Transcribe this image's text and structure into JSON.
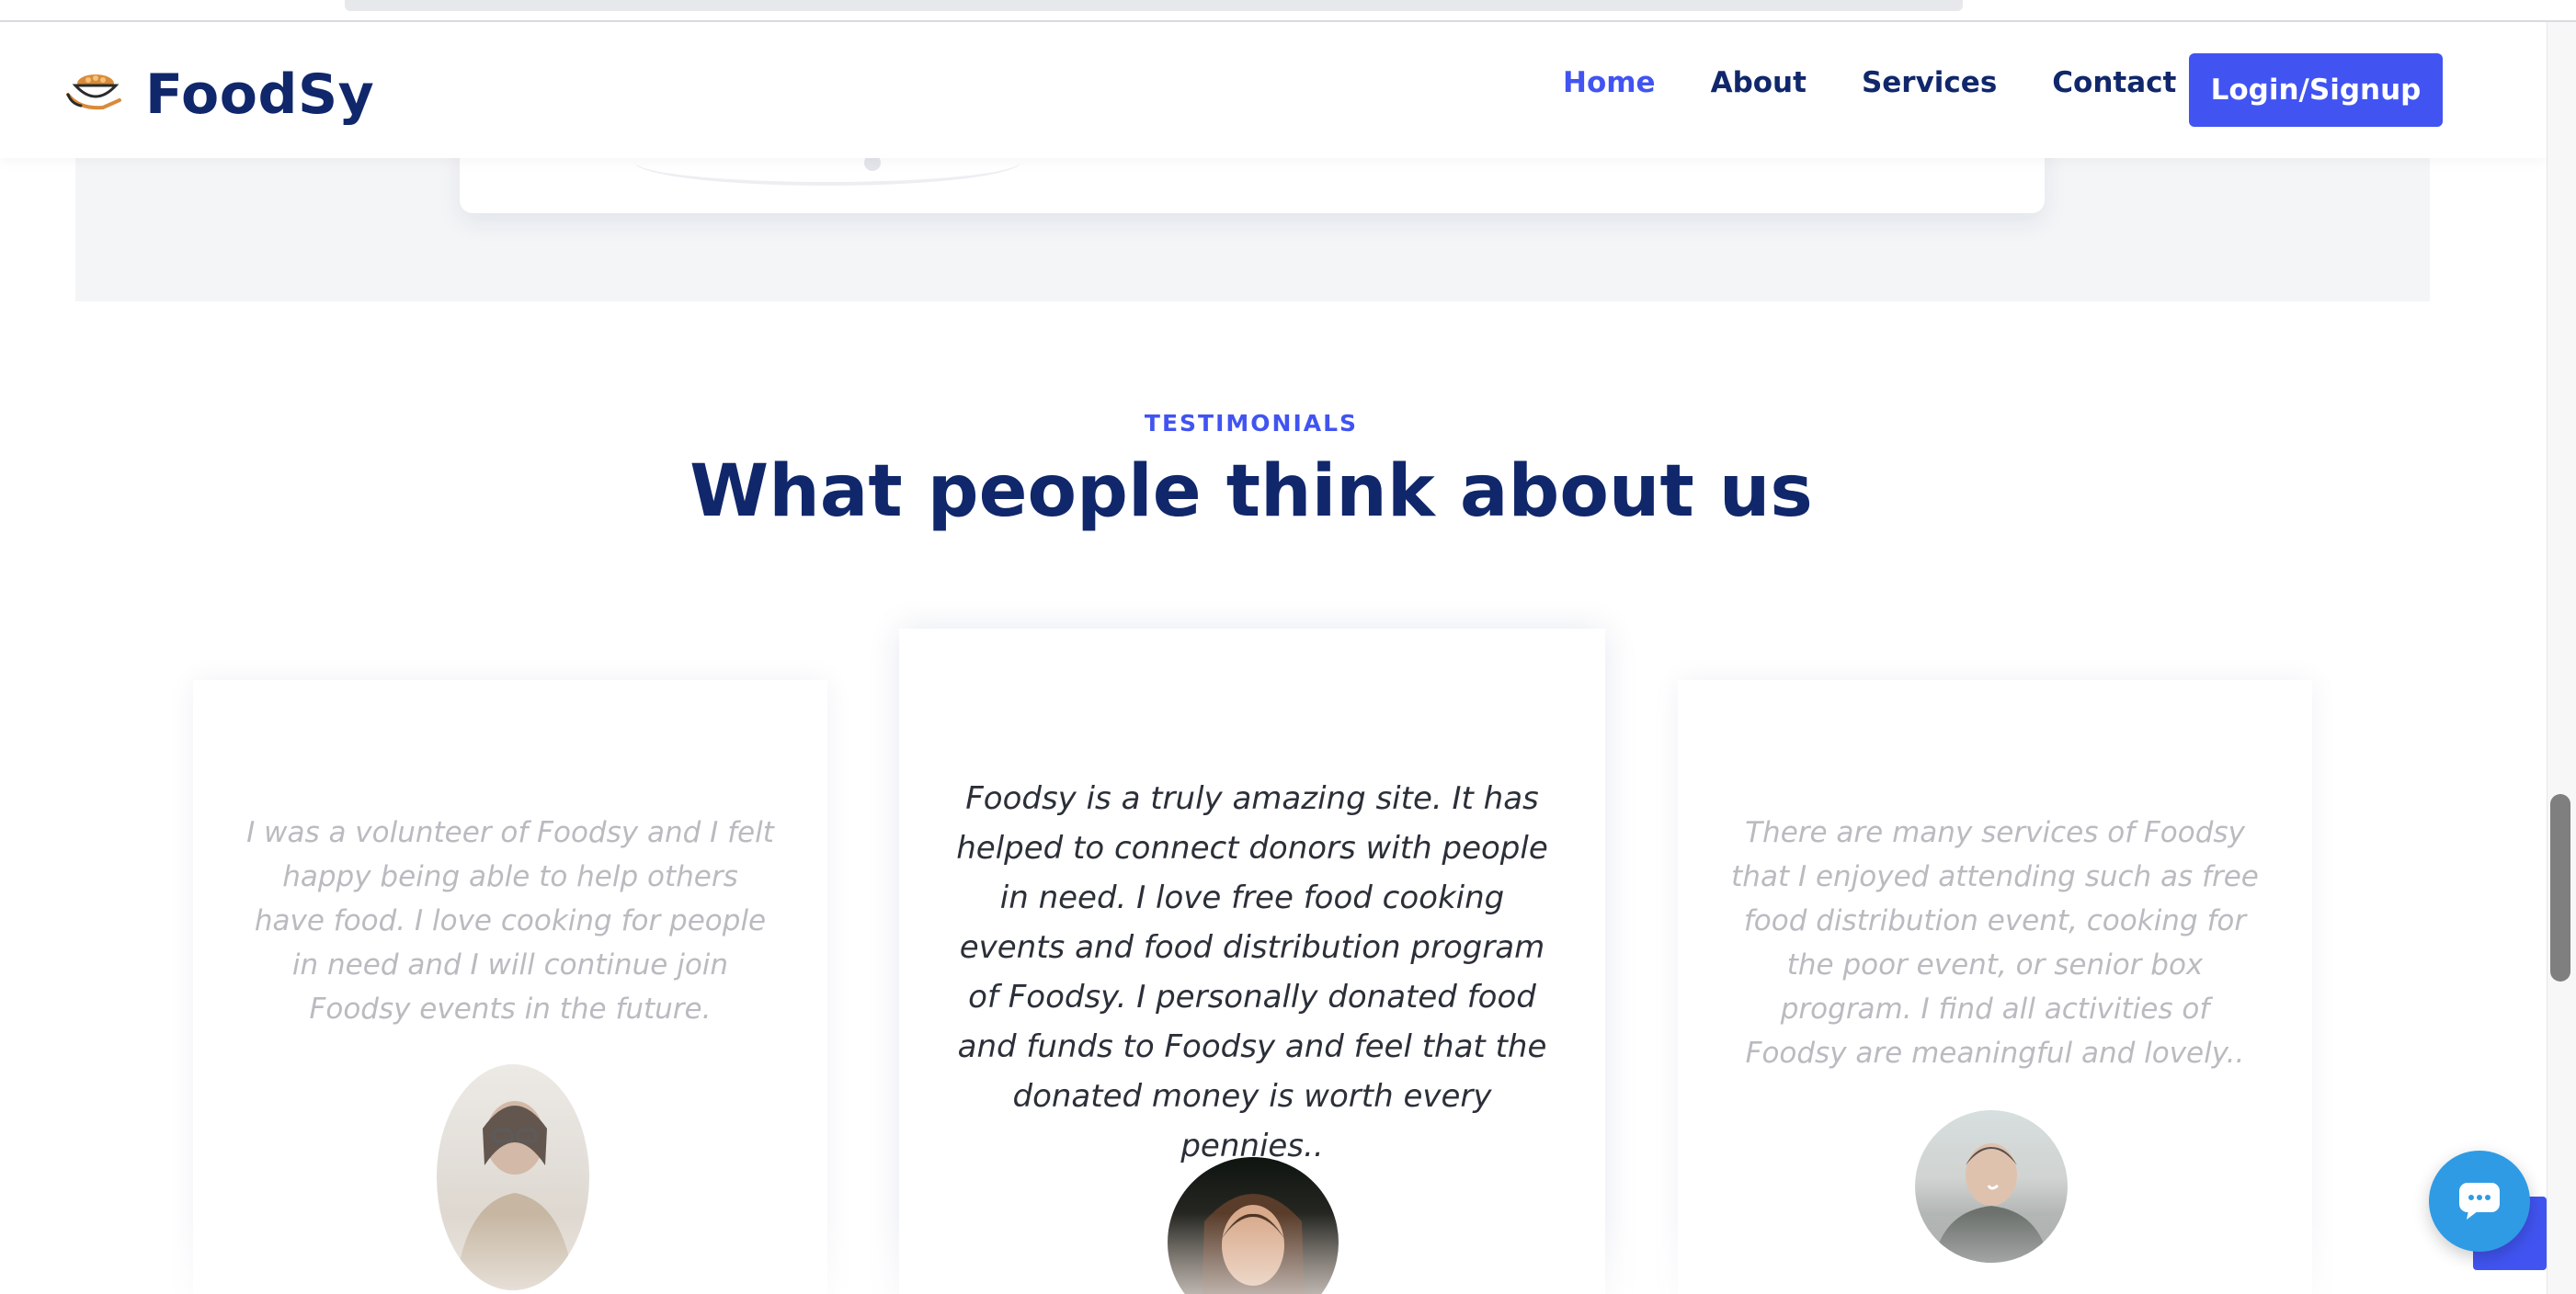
{
  "brand": {
    "name": "FoodSy",
    "icon": "food-bowl-hand-icon"
  },
  "nav": {
    "items": [
      {
        "label": "Home",
        "active": true
      },
      {
        "label": "About",
        "active": false
      },
      {
        "label": "Services",
        "active": false
      },
      {
        "label": "Contact",
        "active": false
      }
    ],
    "cta_label": "Login/Signup"
  },
  "testimonials": {
    "eyebrow": "TESTIMONIALS",
    "heading": "What people think about us",
    "cards": [
      {
        "quote": "I was a volunteer of Foodsy and I felt happy being able to help others have food. I love cooking for people in need and I will continue join Foodsy events in the future.",
        "avatar": "woman-with-glasses-avatar",
        "focused": false
      },
      {
        "quote": "Foodsy is a truly amazing site. It has helped to connect donors with people in need. I love free food cooking events and food distribution program of Foodsy. I personally donated food and funds to Foodsy and feel that the donated money is worth every pennies..",
        "avatar": "young-woman-avatar",
        "focused": true
      },
      {
        "quote": "There are many services of Foodsy that I enjoyed attending such as free food distribution event, cooking for the poor event, or senior box program. I find all activities of Foodsy are meaningful and lovely..",
        "avatar": "smiling-man-avatar",
        "focused": false
      }
    ]
  },
  "widgets": {
    "chat_icon": "chat-bubble-icon",
    "back_to_top_icon": "back-to-top-icon"
  },
  "colors": {
    "accent": "#4154f1",
    "navy": "#10276b",
    "chat": "#2f9be4",
    "muted_text": "#b9bbc0"
  }
}
